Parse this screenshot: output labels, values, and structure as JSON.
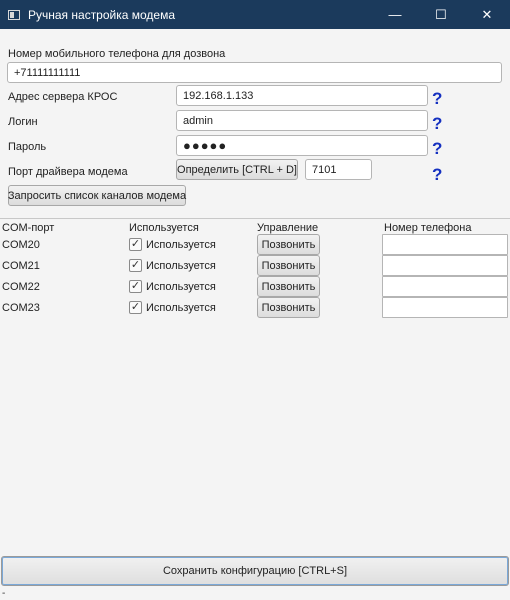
{
  "window": {
    "title": "Ручная настройка модема",
    "minimize_glyph": "—",
    "maximize_glyph": "☐",
    "close_glyph": "✕"
  },
  "phone": {
    "label": "Номер мобильного телефона для дозвона",
    "value": "+71111111111"
  },
  "server": {
    "label": "Адрес сервера КРОС",
    "value": "192.168.1.133"
  },
  "login": {
    "label": "Логин",
    "value": "admin"
  },
  "password": {
    "label": "Пароль",
    "value": "●●●●●"
  },
  "driver_port": {
    "label": "Порт драйвера  модема",
    "detect_button": "Определить [CTRL + D]",
    "value": "7101"
  },
  "help_glyph": "?",
  "request_button": "Запросить список каналов модема",
  "table": {
    "headers": [
      "COM-порт",
      "Используется",
      "Управление",
      "Номер телефона"
    ],
    "rows": [
      {
        "port": "COM20",
        "used_label": "Используется",
        "checked": true,
        "call_label": "Позвонить",
        "phone": ""
      },
      {
        "port": "COM21",
        "used_label": "Используется",
        "checked": true,
        "call_label": "Позвонить",
        "phone": ""
      },
      {
        "port": "COM22",
        "used_label": "Используется",
        "checked": true,
        "call_label": "Позвонить",
        "phone": ""
      },
      {
        "port": "COM23",
        "used_label": "Используется",
        "checked": true,
        "call_label": "Позвонить",
        "phone": ""
      }
    ],
    "check_glyph": "✓"
  },
  "save_button": "Сохранить конфигурацию [CTRL+S]",
  "status_text": "-"
}
